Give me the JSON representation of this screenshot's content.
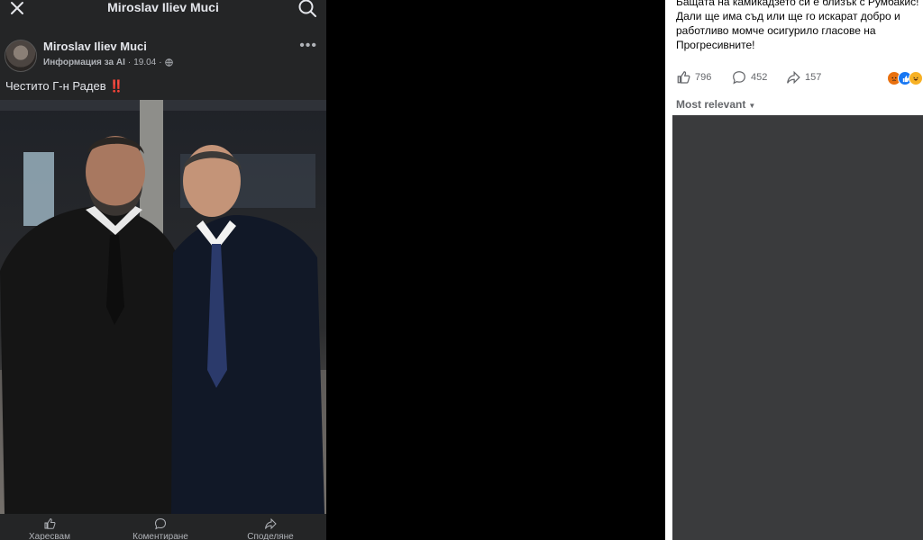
{
  "left_panel": {
    "title": "Miroslav Iliev Muci",
    "icons": {
      "close": "close-icon",
      "search": "search-icon",
      "more": "more-icon"
    },
    "post": {
      "author": "Miroslav Iliev Muci",
      "info_label": "Информация за AI",
      "date": "19.04",
      "privacy_icon": "globe-icon",
      "caption": "Честито Г-н  Радев",
      "caption_mark": "‼️"
    },
    "actions": [
      {
        "label": "Харесвам",
        "icon": "like-icon"
      },
      {
        "label": "Коментиране",
        "icon": "comment-icon"
      },
      {
        "label": "Споделяне",
        "icon": "share-icon"
      }
    ]
  },
  "right_panel": {
    "post_text": "Бащата на камикадзето си е близък с Румбакис! Дали ще има съд или ще го искарат добро и работливо момче осигурило гласове на Прогресивните!",
    "stats": {
      "likes": "796",
      "comments": "452",
      "shares": "157"
    },
    "reactions": [
      "angry",
      "like",
      "haha"
    ],
    "sort_label": "Most relevant",
    "colors": {
      "accent": "#1877f2",
      "dark_bg": "#242526",
      "comments_bg": "#3a3b3d"
    }
  }
}
